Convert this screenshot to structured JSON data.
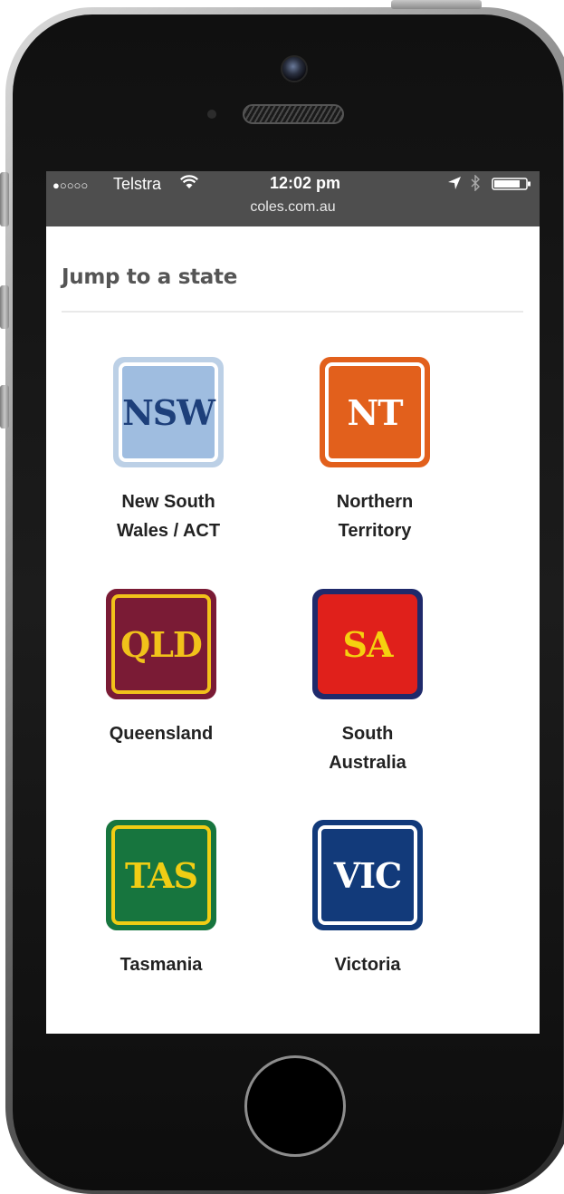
{
  "status_bar": {
    "signal": "●○○○○",
    "carrier": "Telstra",
    "time": "12:02 pm",
    "url": "coles.com.au",
    "icons": [
      "wifi-icon",
      "location-arrow-icon",
      "bluetooth-icon",
      "battery-icon"
    ]
  },
  "page": {
    "heading": "Jump to a state"
  },
  "states": [
    {
      "code": "NSW",
      "label_line1": "New South",
      "label_line2": "Wales / ACT",
      "outer": "#bcd0e6",
      "inner": "#9fbde0",
      "ring": "#ffffff",
      "text": "#1d3f7a"
    },
    {
      "code": "NT",
      "label_line1": "Northern",
      "label_line2": "Territory",
      "outer": "#e2601c",
      "inner": "#e2601c",
      "ring": "#ffffff",
      "text": "#ffffff"
    },
    {
      "code": "QLD",
      "label_line1": "Queensland",
      "label_line2": "",
      "outer": "#7a1b35",
      "inner": "#7a1b35",
      "ring": "#f1c21a",
      "text": "#f1c21a"
    },
    {
      "code": "SA",
      "label_line1": "South",
      "label_line2": "Australia",
      "outer": "#1f2a6b",
      "inner": "#e0201b",
      "ring": "#e0201b",
      "text": "#f5d10f"
    },
    {
      "code": "TAS",
      "label_line1": "Tasmania",
      "label_line2": "",
      "outer": "#17753e",
      "inner": "#17753e",
      "ring": "#f1cd14",
      "text": "#f1cd14"
    },
    {
      "code": "VIC",
      "label_line1": "Victoria",
      "label_line2": "",
      "outer": "#123a7a",
      "inner": "#123a7a",
      "ring": "#ffffff",
      "text": "#ffffff"
    }
  ]
}
